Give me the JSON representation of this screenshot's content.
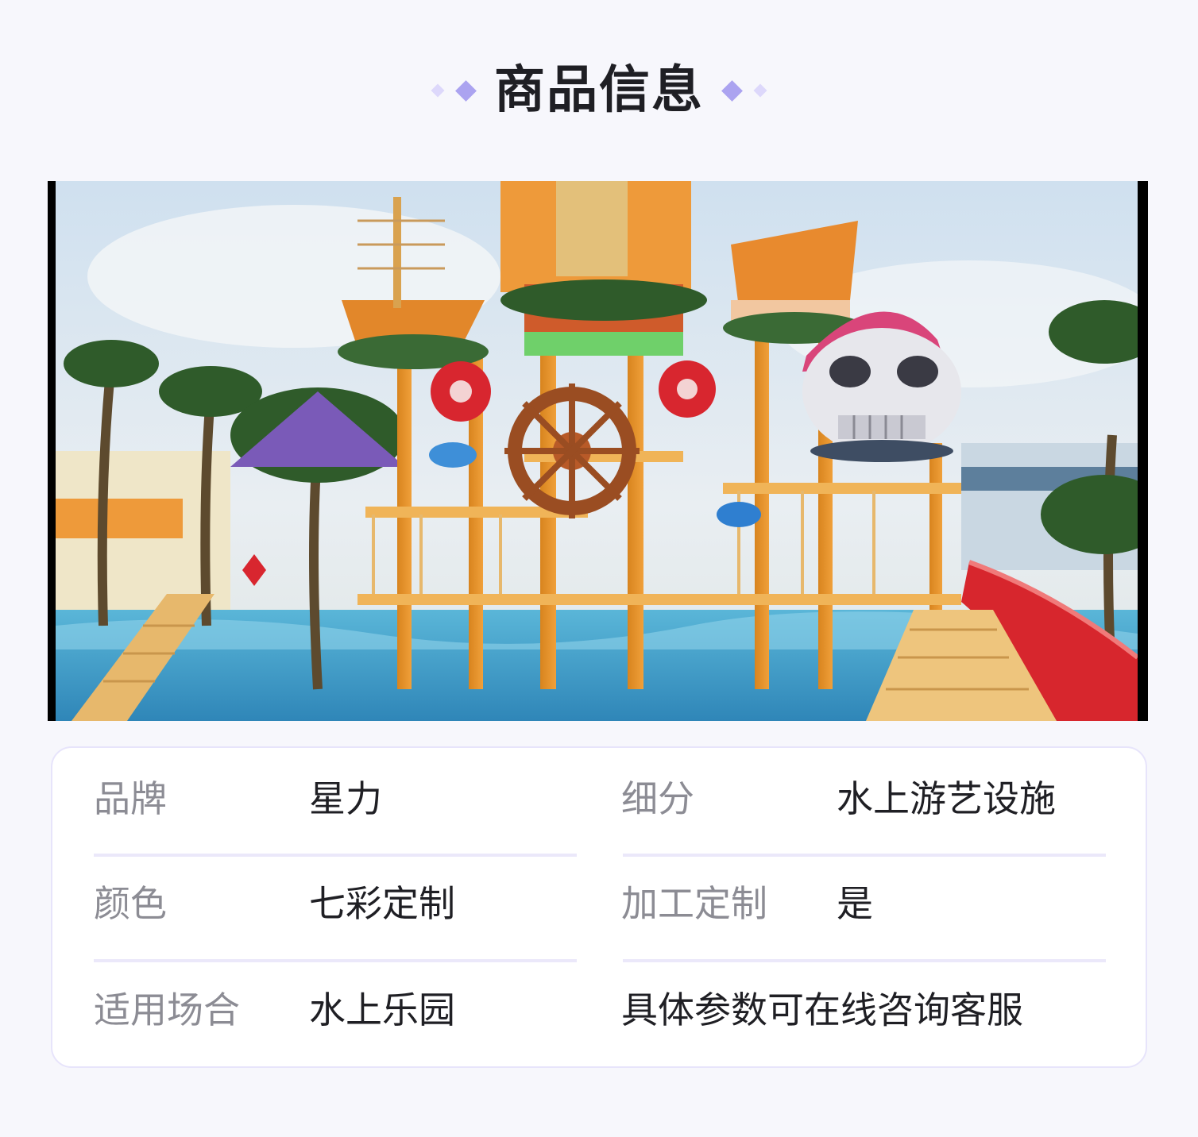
{
  "header": {
    "title": "商品信息"
  },
  "product_image": {
    "description_icon": "water-park-playground-image"
  },
  "info": {
    "brand_label": "品牌",
    "brand_value": "星力",
    "category_label": "细分",
    "category_value": "水上游艺设施",
    "color_label": "颜色",
    "color_value": "七彩定制",
    "custom_label": "加工定制",
    "custom_value": "是",
    "venue_label": "适用场合",
    "venue_value": "水上乐园",
    "note": "具体参数可在线咨询客服"
  },
  "colors": {
    "accent": "#aba3f0",
    "accent_light": "#ddd8fb",
    "page_bg": "#f7f7fc",
    "divider": "#ebe8fa",
    "label_text": "#8c8c94",
    "value_text": "#1f1f24"
  }
}
